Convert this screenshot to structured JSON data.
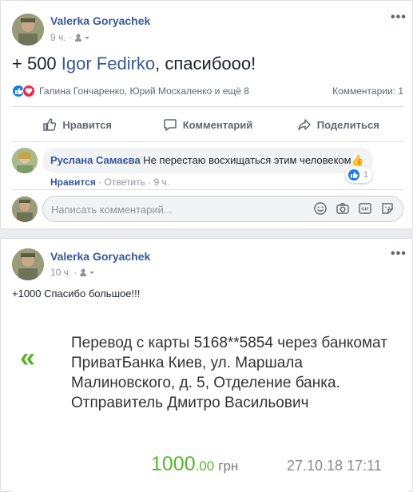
{
  "post1": {
    "author": "Valerka Goryachek",
    "time": "9 ч.",
    "text_prefix": "+ 500 ",
    "mention": "Igor Fedirko",
    "text_suffix": ", спасибооо!",
    "reactions_names": "Галина Гончаренко, Юрий Москаленко и ещё 8",
    "comments_count": "Комментарии: 1",
    "actions": {
      "like": "Нравится",
      "comment": "Комментарий",
      "share": "Поделиться"
    },
    "comment": {
      "author": "Руслана Самаєва",
      "text": "Не перестаю восхищаться этим человеком",
      "emoji": "👍",
      "reaction_count": "1",
      "like_link": "Нравится",
      "reply_link": "Ответить",
      "time": "9 ч."
    },
    "write_placeholder": "Написать комментарий..."
  },
  "post2": {
    "author": "Valerka Goryachek",
    "time": "10 ч.",
    "text": "+1000 Спасибо большое!!!",
    "receipt": {
      "chevrons": "«",
      "description": "Перевод с карты 5168**5854 через банкомат ПриватБанка Киев, ул. Маршала Малиновского, д. 5, Отделение банка. Отправитель              Дмитро Васильович",
      "amount_int": "1000",
      "amount_dec": ".00",
      "currency": "грн",
      "date": "27.10.18 17:11"
    }
  },
  "colors": {
    "link": "#385898",
    "accent_green": "#57b52c",
    "like_blue": "#1877f2",
    "love_red": "#f0284a"
  },
  "icons": [
    "more-icon",
    "audience-icon",
    "like-icon",
    "love-icon",
    "comment-icon",
    "share-icon",
    "emoji-icon",
    "camera-icon",
    "gif-icon",
    "sticker-icon"
  ]
}
